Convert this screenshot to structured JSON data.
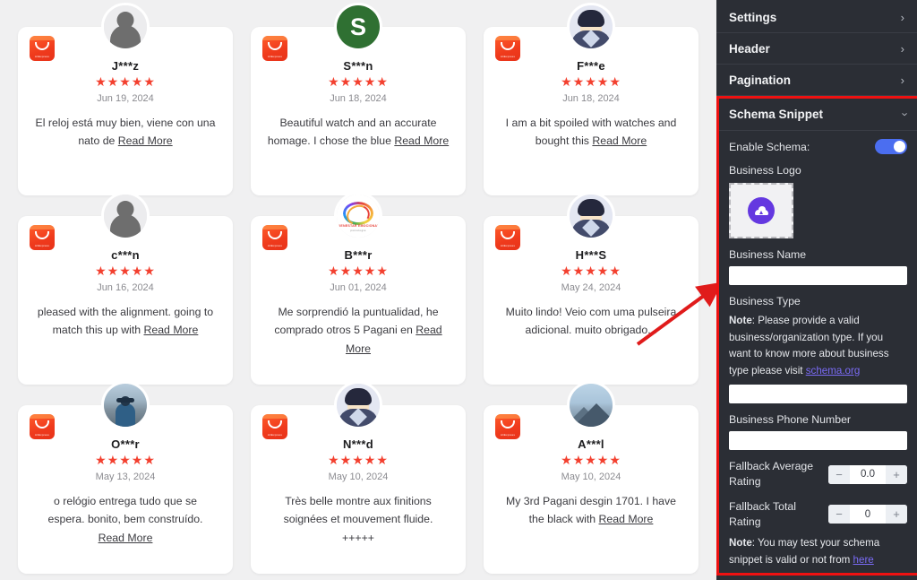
{
  "reviews": [
    {
      "source_icon": "aliexpress-icon",
      "source_label": "AliExpress",
      "avatar_type": "silhouette",
      "avatar_label": "default-user-avatar",
      "name": "J***z",
      "stars": "★★★★★",
      "rating": 5,
      "date": "Jun 19, 2024",
      "text": "El reloj está muy bien, viene con una nato de ",
      "read_more": "Read More"
    },
    {
      "source_icon": "aliexpress-icon",
      "source_label": "AliExpress",
      "avatar_type": "letter",
      "avatar_letter": "S",
      "avatar_color": "#2f7032",
      "avatar_label": "letter-avatar",
      "name": "S***n",
      "stars": "★★★★★",
      "rating": 5,
      "date": "Jun 18, 2024",
      "text": "Beautiful watch and an accurate homage. I chose the blue ",
      "read_more": "Read More"
    },
    {
      "source_icon": "aliexpress-icon",
      "source_label": "AliExpress",
      "avatar_type": "person",
      "avatar_label": "person-illustration-avatar",
      "name": "F***e",
      "stars": "★★★★★",
      "rating": 5,
      "date": "Jun 18, 2024",
      "text": "I am a bit spoiled with watches and bought this ",
      "read_more": "Read More"
    },
    {
      "source_icon": "aliexpress-icon",
      "source_label": "AliExpress",
      "avatar_type": "silhouette",
      "avatar_label": "default-user-avatar",
      "name": "c***n",
      "stars": "★★★★★",
      "rating": 5,
      "date": "Jun 16, 2024",
      "text": "pleased with the alignment. going to match this up with ",
      "read_more": "Read More"
    },
    {
      "source_icon": "aliexpress-icon",
      "source_label": "AliExpress",
      "avatar_type": "logo",
      "avatar_label": "brand-logo-avatar",
      "avatar_logo_line1": "BIENESTAR EMOCIONAL",
      "avatar_logo_line2": "psicologia",
      "name": "B***r",
      "stars": "★★★★★",
      "rating": 5,
      "date": "Jun 01, 2024",
      "text": "Me sorprendió la puntualidad, he comprado otros 5 Pagani en ",
      "read_more": "Read More"
    },
    {
      "source_icon": "aliexpress-icon",
      "source_label": "AliExpress",
      "avatar_type": "person",
      "avatar_label": "person-illustration-avatar",
      "name": "H***S",
      "stars": "★★★★★",
      "rating": 5,
      "date": "May 24, 2024",
      "text": "Muito lindo! Veio com uma pulseira adicional. muito obrigado...",
      "read_more": ""
    },
    {
      "source_icon": "aliexpress-icon",
      "source_label": "AliExpress",
      "avatar_type": "photo-hiker",
      "avatar_label": "photo-avatar",
      "name": "O***r",
      "stars": "★★★★★",
      "rating": 5,
      "date": "May 13, 2024",
      "text": "o relógio entrega tudo que se espera. bonito, bem construído. ",
      "read_more": "Read More"
    },
    {
      "source_icon": "aliexpress-icon",
      "source_label": "AliExpress",
      "avatar_type": "person",
      "avatar_label": "person-illustration-avatar",
      "name": "N***d",
      "stars": "★★★★★",
      "rating": 5,
      "date": "May 10, 2024",
      "text": "Très belle montre aux finitions soignées et mouvement fluide. +++++",
      "read_more": ""
    },
    {
      "source_icon": "aliexpress-icon",
      "source_label": "AliExpress",
      "avatar_type": "photo-mountain",
      "avatar_label": "photo-avatar",
      "name": "A***l",
      "stars": "★★★★★",
      "rating": 5,
      "date": "May 10, 2024",
      "text": "My 3rd Pagani desgin 1701. I have the black with ",
      "read_more": "Read More"
    }
  ],
  "sidebar": {
    "accordions": [
      {
        "label": "Settings",
        "icon": "chevron-right-icon",
        "expanded": false
      },
      {
        "label": "Header",
        "icon": "chevron-right-icon",
        "expanded": false
      },
      {
        "label": "Pagination",
        "icon": "chevron-right-icon",
        "expanded": false
      }
    ],
    "schema_panel": {
      "title": "Schema Snippet",
      "chevron": "chevron-down-icon",
      "highlight_color": "#ee1111",
      "enable_schema": {
        "label": "Enable Schema:",
        "on": true,
        "accent_color": "#4b6ef0"
      },
      "business_logo": {
        "label": "Business Logo",
        "upload_icon": "cloud-upload-icon",
        "upload_color": "#6438e0"
      },
      "business_name": {
        "label": "Business Name",
        "value": "",
        "placeholder": ""
      },
      "business_type": {
        "label": "Business Type",
        "note_bold": "Note",
        "note_text": ": Please provide a valid business/organization type. If you want to know more about business type please visit ",
        "note_link": "schema.org",
        "value": "",
        "placeholder": ""
      },
      "business_phone": {
        "label": "Business Phone Number",
        "value": "",
        "placeholder": ""
      },
      "fallback_average_rating": {
        "label": "Fallback Average Rating",
        "value": "0.0",
        "minus": "−",
        "plus": "+"
      },
      "fallback_total_rating": {
        "label": "Fallback Total Rating",
        "value": "0",
        "minus": "−",
        "plus": "+"
      },
      "footer_note": {
        "bold": "Note",
        "text": ": You may test your schema snippet is valid or not from ",
        "link": "here"
      }
    }
  },
  "annotation": {
    "type": "arrow",
    "color": "#e01b1b",
    "points_to": "schema-snippet-panel"
  }
}
